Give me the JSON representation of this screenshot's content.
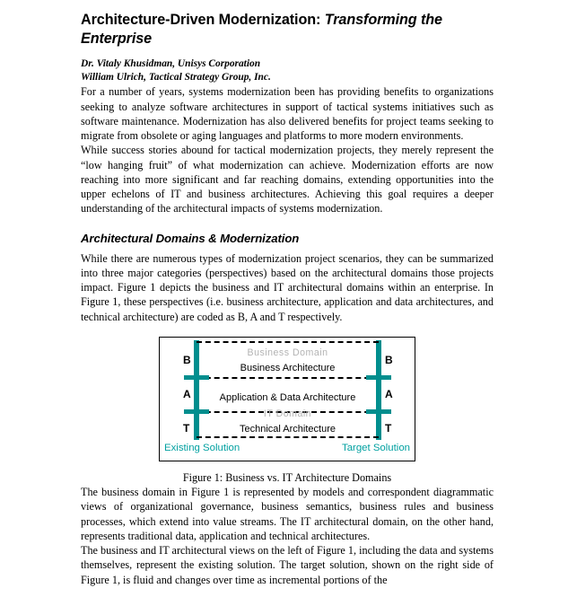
{
  "document": {
    "title_main": "Architecture-Driven Modernization: ",
    "title_italic": "Transforming the Enterprise",
    "authors": [
      "Dr. Vitaly Khusidman, Unisys Corporation",
      "William Ulrich, Tactical Strategy Group, Inc."
    ],
    "paragraphs": {
      "p1": "For a number of years, systems modernization been has providing benefits to organizations seeking to analyze software architectures in support of tactical systems initiatives such as software maintenance. Modernization has also delivered benefits for project teams seeking to migrate from obsolete or aging languages and platforms to more modern environments.",
      "p2": "While success stories abound for tactical modernization projects, they merely represent the “low hanging fruit” of what modernization can achieve. Modernization efforts are now reaching into more significant and far reaching domains, extending opportunities into the upper echelons of IT and business architectures. Achieving this goal requires a deeper understanding of the architectural impacts of systems modernization.",
      "p3": "While there are numerous types of modernization project scenarios, they can be summarized into three major categories (perspectives) based on the architectural domains those projects impact. Figure 1 depicts the business and IT architectural domains within an enterprise. In Figure 1, these perspectives (i.e. business architecture, application and data architectures, and technical architecture) are coded as B, A and T respectively.",
      "p4": "The business domain in Figure 1 is represented by models and correspondent diagrammatic views of organizational governance, business semantics, business rules and business processes, which extend into value streams. The IT architectural domain, on the other hand, represents traditional data, application and technical architectures.",
      "p5": "The business and IT architectural views on the left of Figure 1, including the data and systems themselves, represent the existing solution. The target solution, shown on the right side of Figure 1, is fluid and changes over time as incremental portions of the"
    },
    "section_heading": "Architectural Domains & Modernization",
    "figure_caption": "Figure 1:  Business vs. IT Architecture Domains"
  },
  "figure": {
    "left_axis_labels": {
      "b": "B",
      "a": "A",
      "t": "T"
    },
    "right_axis_labels": {
      "b": "B",
      "a": "A",
      "t": "T"
    },
    "business_domain": "Business Domain",
    "business_architecture": "Business Architecture",
    "application_data_architecture": "Application & Data Architecture",
    "it_domain": "IT Domain",
    "technical_architecture": "Technical Architecture",
    "existing_solution": "Existing Solution",
    "target_solution": "Target Solution",
    "colors": {
      "teal_bar": "#008e8e",
      "solution_label": "#00a0a0",
      "domain_label_gray": "#b3b3b3",
      "border": "#000000"
    }
  }
}
